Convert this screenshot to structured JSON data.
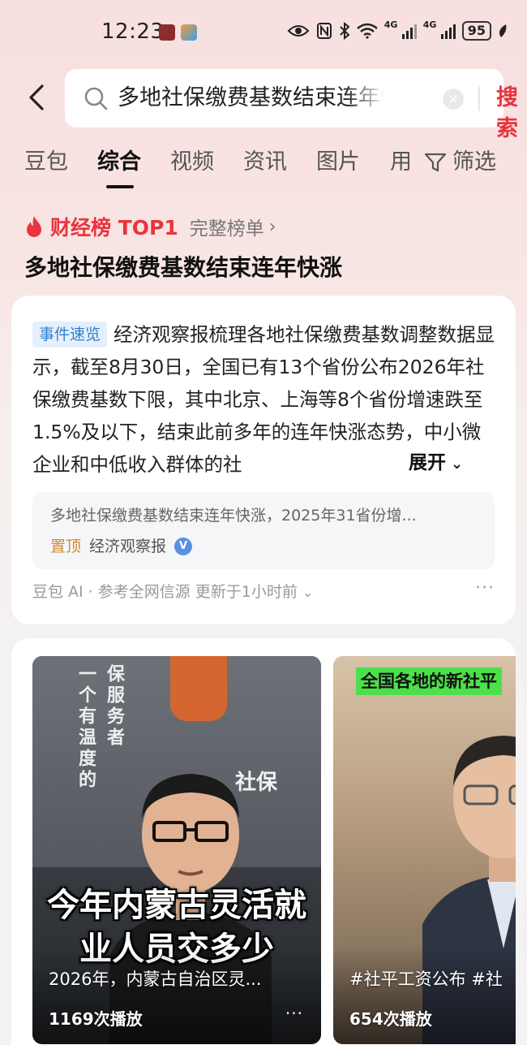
{
  "status_bar": {
    "time": "12:23",
    "network1": "4G",
    "network2": "4G",
    "battery": "95"
  },
  "search": {
    "query": "多地社保缴费基数结束连年快涨",
    "button_label": "搜索",
    "clear_icon": "×"
  },
  "tabs": [
    {
      "label": "豆包",
      "active": false
    },
    {
      "label": "综合",
      "active": true
    },
    {
      "label": "视频",
      "active": false
    },
    {
      "label": "资讯",
      "active": false
    },
    {
      "label": "图片",
      "active": false
    },
    {
      "label": "用",
      "active": false
    }
  ],
  "filter_label": "筛选",
  "trending": {
    "tag": "财经榜 TOP1",
    "more_label": "完整榜单",
    "chevron": "›",
    "headline": "多地社保缴费基数结束连年快涨"
  },
  "summary_card": {
    "badge": "事件速览",
    "text": "经济观察报梳理各地社保缴费基数调整数据显示，截至8月30日，全国已有13个省份公布2026年社保缴费基数下限，其中北京、上海等8个省份增速跌至1.5%及以下，结束此前多年的连年快涨态势，中小微企业和中低收入群体的社",
    "expand_label": "展开",
    "expand_chevron": "⌄",
    "source": {
      "title": "多地社保缴费基数结束连年快涨，2025年31省份增...",
      "pin_label": "置顶",
      "publisher": "经济观察报",
      "verified_mark": "V"
    },
    "footer": "豆包 AI · 参考全网信源 更新于1小时前",
    "footer_chevron": "⌄",
    "more": "···"
  },
  "videos": [
    {
      "overlay_vertical_1": "一个有温度的",
      "overlay_vertical_2": "保服务者",
      "overlay_brand": "社保",
      "caption": "今年内蒙古灵活就业人员交多少",
      "title": "2026年，内蒙古自治区灵...",
      "plays": "1169次播放",
      "more": "···"
    },
    {
      "banner": "全国各地的新社平",
      "title": "#社平工资公布 #社",
      "plays": "654次播放"
    }
  ],
  "colors": {
    "accent_red": "#e8353f",
    "badge_blue": "#2f7fd0",
    "pin_orange": "#d3892b",
    "banner_green": "#4ce04a"
  }
}
